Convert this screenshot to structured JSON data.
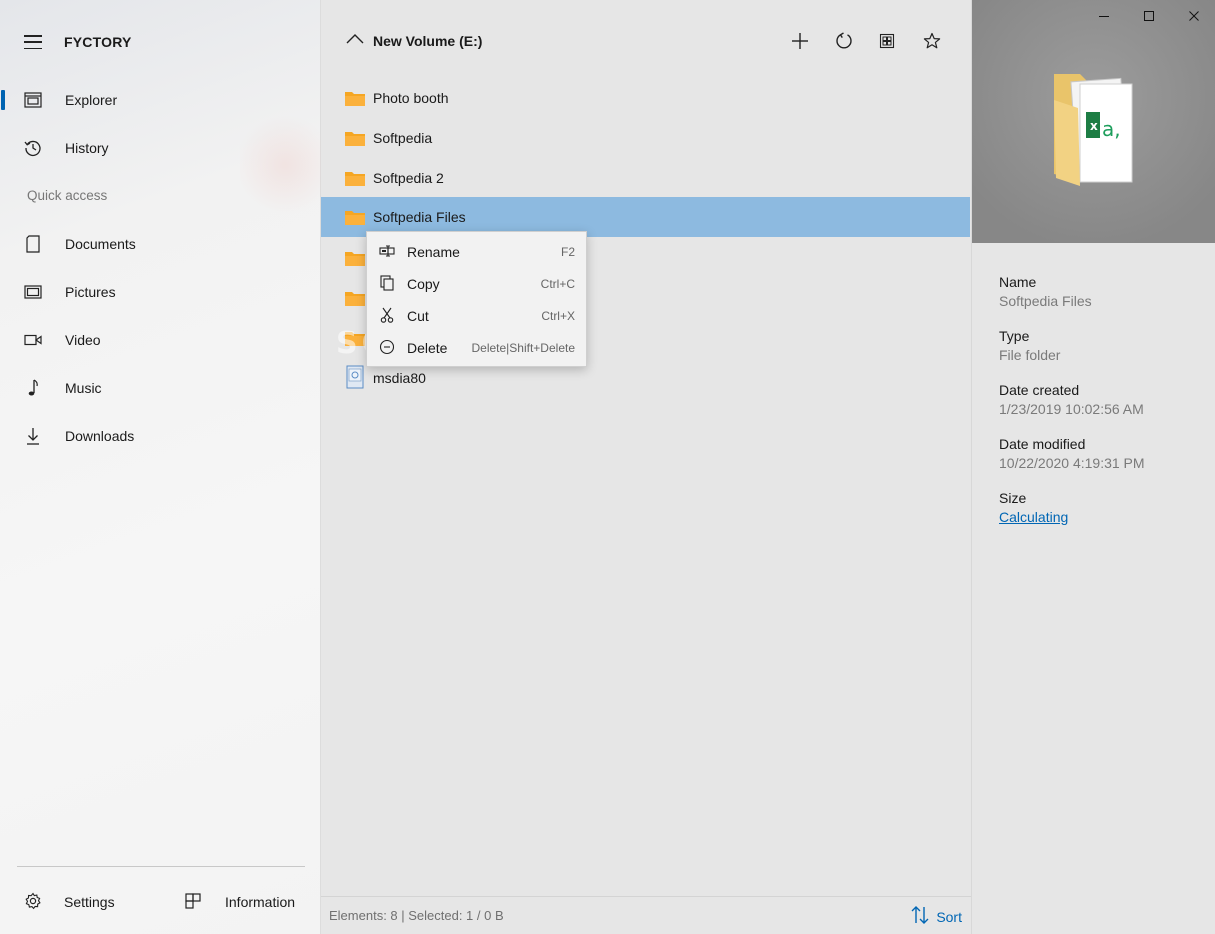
{
  "app": {
    "title": "FYCTORY"
  },
  "sidebar": {
    "nav": [
      {
        "label": "Explorer",
        "icon": "explorer-icon",
        "active": true
      },
      {
        "label": "History",
        "icon": "history-icon"
      }
    ],
    "section_label": "Quick access",
    "quick_access": [
      {
        "label": "Documents",
        "icon": "document-icon"
      },
      {
        "label": "Pictures",
        "icon": "pictures-icon"
      },
      {
        "label": "Video",
        "icon": "video-icon"
      },
      {
        "label": "Music",
        "icon": "music-icon"
      },
      {
        "label": "Downloads",
        "icon": "download-icon"
      }
    ],
    "bottom": {
      "settings_label": "Settings",
      "information_label": "Information"
    }
  },
  "main": {
    "title": "New Volume (E:)",
    "files": [
      {
        "name": "Photo booth",
        "type": "folder"
      },
      {
        "name": "Softpedia",
        "type": "folder"
      },
      {
        "name": "Softpedia 2",
        "type": "folder"
      },
      {
        "name": "Softpedia Files",
        "type": "folder",
        "selected": true
      },
      {
        "name": "",
        "type": "folder"
      },
      {
        "name": "",
        "type": "folder"
      },
      {
        "name": "",
        "type": "folder"
      },
      {
        "name": "msdia80",
        "type": "file"
      }
    ],
    "status_text": "Elements: 8 |  Selected: 1 / 0 B",
    "sort_label": "Sort"
  },
  "context_menu": {
    "items": [
      {
        "label": "Rename",
        "shortcut": "F2",
        "icon": "rename-icon"
      },
      {
        "label": "Copy",
        "shortcut": "Ctrl+C",
        "icon": "copy-icon"
      },
      {
        "label": "Cut",
        "shortcut": "Ctrl+X",
        "icon": "cut-icon"
      },
      {
        "label": "Delete",
        "shortcut": "Delete|Shift+Delete",
        "icon": "delete-icon"
      }
    ]
  },
  "watermark": "SOFTPEDIA",
  "details": {
    "props": [
      {
        "key": "Name",
        "value": "Softpedia Files"
      },
      {
        "key": "Type",
        "value": "File folder"
      },
      {
        "key": "Date created",
        "value": "1/23/2019 10:02:56 AM"
      },
      {
        "key": "Date modified",
        "value": "10/22/2020 4:19:31 PM"
      },
      {
        "key": "Size",
        "value": "Calculating",
        "link": true
      }
    ]
  },
  "colors": {
    "accent": "#0063b1",
    "selection": "#8dbae0",
    "folder": "#f5a623",
    "link": "#0066b4"
  }
}
